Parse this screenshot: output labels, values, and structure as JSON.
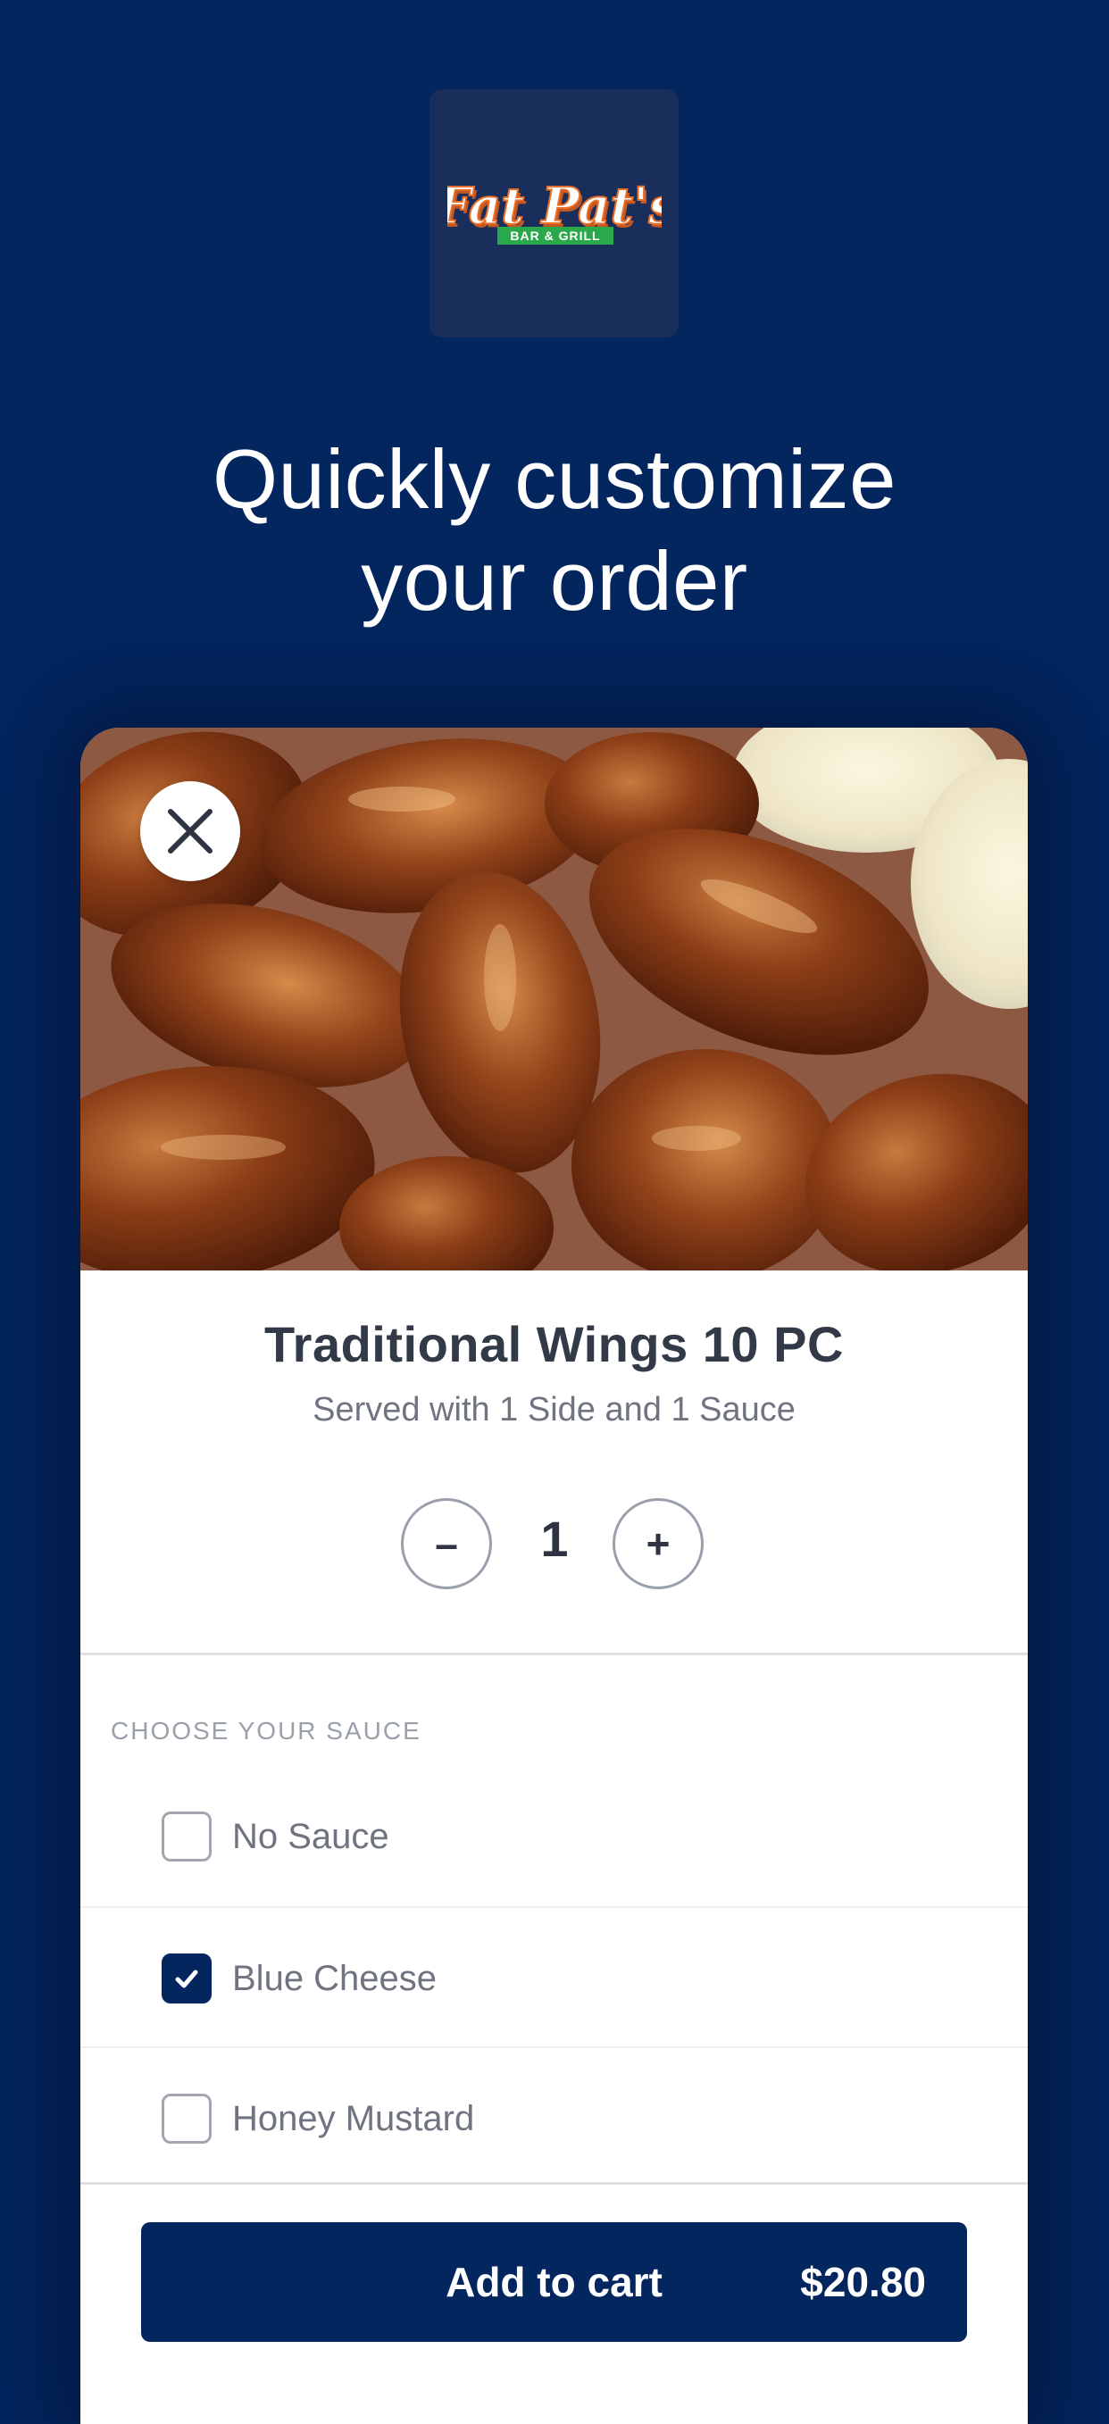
{
  "brand": {
    "logo_text": "Fat Pat's",
    "logo_subtext": "BAR & GRILL"
  },
  "headline": {
    "line1": "Quickly customize",
    "line2": "your order"
  },
  "item": {
    "image_description_icon": "chicken-wings-photo",
    "title": "Traditional Wings 10 PC",
    "subtitle": "Served with 1 Side and 1 Sauce",
    "quantity": "1",
    "minus_label": "–",
    "plus_label": "+"
  },
  "sauce_section": {
    "label": "CHOOSE YOUR SAUCE",
    "options": [
      {
        "label": "No Sauce",
        "checked": false
      },
      {
        "label": "Blue Cheese",
        "checked": true
      },
      {
        "label": "Honey Mustard",
        "checked": false
      }
    ]
  },
  "cart": {
    "button_label": "Add to cart",
    "price": "$20.80"
  },
  "colors": {
    "background": "#03265f",
    "logo_tile": "#192e5a",
    "accent_orange": "#e9702b",
    "accent_green": "#2aa84a",
    "text_dark": "#333a47",
    "text_muted": "#6f7480"
  }
}
